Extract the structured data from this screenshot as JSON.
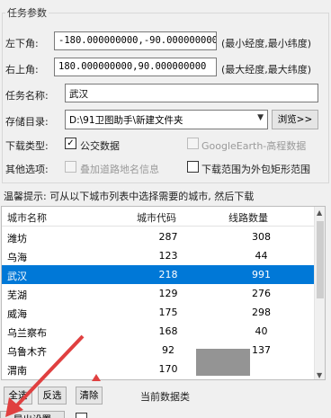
{
  "group": {
    "title": "任务参数"
  },
  "lower_left": {
    "label": "左下角:",
    "value": "-180.000000000,-90.000000000",
    "note": "(最小经度,最小纬度)"
  },
  "upper_right": {
    "label": "右上角:",
    "value": "180.000000000,90.000000000",
    "note": "(最大经度,最大纬度)"
  },
  "task_name": {
    "label": "任务名称:",
    "value": "武汉"
  },
  "storage_dir": {
    "label": "存储目录:",
    "value": "D:\\91卫图助手\\新建文件夹",
    "browse_label": "浏览>>"
  },
  "download_type": {
    "label": "下载类型:",
    "bus_label": "公交数据",
    "bus_checked": true,
    "ge_label": "GoogleEarth-高程数据",
    "ge_checked": false
  },
  "other_options": {
    "label": "其他选项:",
    "overlay_label": "叠加道路地名信息",
    "overlay_checked": false,
    "bbox_label": "下载范围为外包矩形范围",
    "bbox_checked": false
  },
  "tip": "温馨提示: 可从以下城市列表中选择需要的城市, 然后下载",
  "table": {
    "headers": [
      "城市名称",
      "城市代码",
      "线路数量"
    ],
    "rows": [
      {
        "name": "潍坊",
        "code": "287",
        "count": "308",
        "selected": false
      },
      {
        "name": "乌海",
        "code": "123",
        "count": "44",
        "selected": false
      },
      {
        "name": "武汉",
        "code": "218",
        "count": "991",
        "selected": true
      },
      {
        "name": "芜湖",
        "code": "129",
        "count": "276",
        "selected": false
      },
      {
        "name": "威海",
        "code": "175",
        "count": "298",
        "selected": false
      },
      {
        "name": "乌兰察布",
        "code": "168",
        "count": "40",
        "selected": false
      },
      {
        "name": "乌鲁木齐",
        "code": "92",
        "count": "137",
        "selected": false
      },
      {
        "name": "渭南",
        "code": "170",
        "count": "",
        "selected": false
      }
    ]
  },
  "bottom": {
    "select_all": "全选",
    "invert": "反选",
    "clear": "清除",
    "status": "当前数据类",
    "export_settings": "导出设置"
  },
  "colors": {
    "selection": "#0078d7",
    "arrow": "#e04040"
  }
}
